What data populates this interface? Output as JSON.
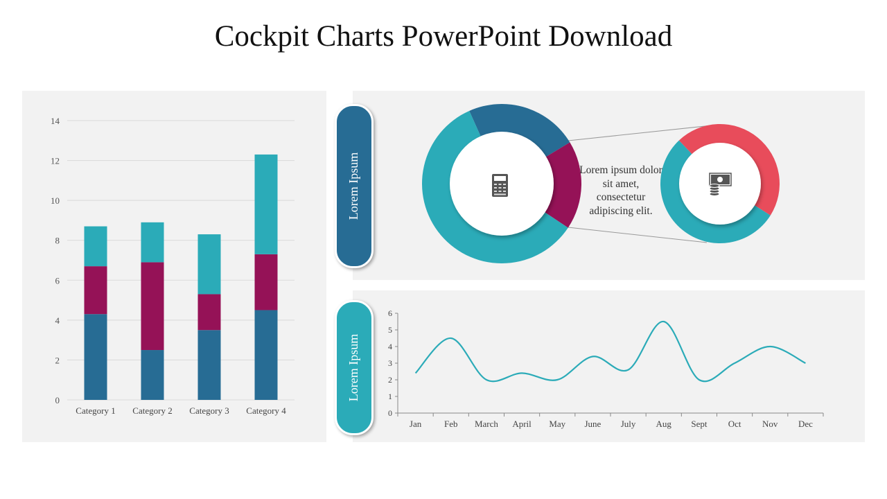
{
  "title": "Cockpit Charts PowerPoint Download",
  "colors": {
    "dark_blue": "#276C94",
    "magenta": "#951257",
    "teal": "#2BABB8",
    "red": "#E84C5B",
    "panel": "#F2F2F2"
  },
  "pills": [
    {
      "label": "Lorem Ipsum",
      "color": "#276C94"
    },
    {
      "label": "Lorem Ipsum",
      "color": "#2BABB8"
    }
  ],
  "description": "Lorem ipsum dolor sit amet, consectetur adipiscing elit.",
  "icons": {
    "donut_main": "calculator-icon",
    "donut_detail": "money-coins-icon"
  },
  "chart_data": [
    {
      "type": "bar",
      "stacked": true,
      "categories": [
        "Category 1",
        "Category 2",
        "Category 3",
        "Category 4"
      ],
      "series": [
        {
          "values": [
            4.3,
            2.5,
            3.5,
            4.5
          ],
          "color": "#276C94"
        },
        {
          "values": [
            2.4,
            4.4,
            1.8,
            2.8
          ],
          "color": "#951257"
        },
        {
          "values": [
            2.0,
            2.0,
            3.0,
            5.0
          ],
          "color": "#2BABB8"
        }
      ],
      "ylim": [
        0,
        14
      ],
      "yticks": [
        0,
        2,
        4,
        6,
        8,
        10,
        12,
        14
      ],
      "grid": true
    },
    {
      "type": "pie",
      "donut": true,
      "values": [
        23,
        18,
        59
      ],
      "colors": [
        "#276C94",
        "#951257",
        "#2BABB8"
      ]
    },
    {
      "type": "pie",
      "donut": true,
      "values": [
        46,
        54
      ],
      "colors": [
        "#E84C5B",
        "#2BABB8"
      ]
    },
    {
      "type": "line",
      "smooth": true,
      "categories": [
        "Jan",
        "Feb",
        "March",
        "April",
        "May",
        "June",
        "July",
        "Aug",
        "Sept",
        "Oct",
        "Nov",
        "Dec"
      ],
      "values": [
        2.4,
        4.5,
        2.0,
        2.4,
        2.0,
        3.4,
        2.6,
        5.5,
        2.0,
        3.0,
        4.0,
        3.0
      ],
      "color": "#2BABB8",
      "ylim": [
        0,
        6
      ],
      "yticks": [
        0,
        1,
        2,
        3,
        4,
        5,
        6
      ],
      "grid": false
    }
  ]
}
